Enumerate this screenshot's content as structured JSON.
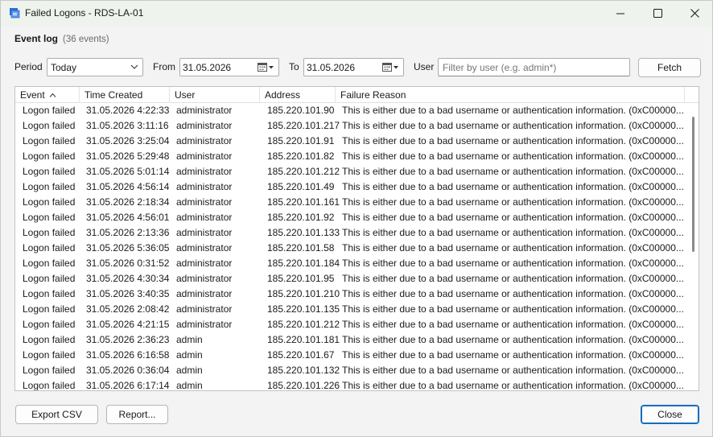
{
  "window": {
    "title": "Failed Logons - RDS-LA-01"
  },
  "header": {
    "title": "Event log",
    "count": "(36 events)"
  },
  "toolbar": {
    "period_label": "Period",
    "period_value": "Today",
    "from_label": "From",
    "from_value": "31.05.2026",
    "to_label": "To",
    "to_value": "31.05.2026",
    "user_label": "User",
    "user_placeholder": "Filter by user (e.g. admin*)",
    "fetch_label": "Fetch"
  },
  "grid": {
    "columns": [
      "Event",
      "Time Created",
      "User",
      "Address",
      "Failure Reason"
    ],
    "sort_indicator": "^",
    "rows": [
      [
        "Logon failed",
        "31.05.2026 4:22:33",
        "administrator",
        "185.220.101.90",
        "This is either due to a bad username or authentication information. (0xC00000..."
      ],
      [
        "Logon failed",
        "31.05.2026 3:11:16",
        "administrator",
        "185.220.101.217",
        "This is either due to a bad username or authentication information. (0xC00000..."
      ],
      [
        "Logon failed",
        "31.05.2026 3:25:04",
        "administrator",
        "185.220.101.91",
        "This is either due to a bad username or authentication information. (0xC00000..."
      ],
      [
        "Logon failed",
        "31.05.2026 5:29:48",
        "administrator",
        "185.220.101.82",
        "This is either due to a bad username or authentication information. (0xC00000..."
      ],
      [
        "Logon failed",
        "31.05.2026 5:01:14",
        "administrator",
        "185.220.101.212",
        "This is either due to a bad username or authentication information. (0xC00000..."
      ],
      [
        "Logon failed",
        "31.05.2026 4:56:14",
        "administrator",
        "185.220.101.49",
        "This is either due to a bad username or authentication information. (0xC00000..."
      ],
      [
        "Logon failed",
        "31.05.2026 2:18:34",
        "administrator",
        "185.220.101.161",
        "This is either due to a bad username or authentication information. (0xC00000..."
      ],
      [
        "Logon failed",
        "31.05.2026 4:56:01",
        "administrator",
        "185.220.101.92",
        "This is either due to a bad username or authentication information. (0xC00000..."
      ],
      [
        "Logon failed",
        "31.05.2026 2:13:36",
        "administrator",
        "185.220.101.133",
        "This is either due to a bad username or authentication information. (0xC00000..."
      ],
      [
        "Logon failed",
        "31.05.2026 5:36:05",
        "administrator",
        "185.220.101.58",
        "This is either due to a bad username or authentication information. (0xC00000..."
      ],
      [
        "Logon failed",
        "31.05.2026 0:31:52",
        "administrator",
        "185.220.101.184",
        "This is either due to a bad username or authentication information. (0xC00000..."
      ],
      [
        "Logon failed",
        "31.05.2026 4:30:34",
        "administrator",
        "185.220.101.95",
        "This is either due to a bad username or authentication information. (0xC00000..."
      ],
      [
        "Logon failed",
        "31.05.2026 3:40:35",
        "administrator",
        "185.220.101.210",
        "This is either due to a bad username or authentication information. (0xC00000..."
      ],
      [
        "Logon failed",
        "31.05.2026 2:08:42",
        "administrator",
        "185.220.101.135",
        "This is either due to a bad username or authentication information. (0xC00000..."
      ],
      [
        "Logon failed",
        "31.05.2026 4:21:15",
        "administrator",
        "185.220.101.212",
        "This is either due to a bad username or authentication information. (0xC00000..."
      ],
      [
        "Logon failed",
        "31.05.2026 2:36:23",
        "admin",
        "185.220.101.181",
        "This is either due to a bad username or authentication information. (0xC00000..."
      ],
      [
        "Logon failed",
        "31.05.2026 6:16:58",
        "admin",
        "185.220.101.67",
        "This is either due to a bad username or authentication information. (0xC00000..."
      ],
      [
        "Logon failed",
        "31.05.2026 0:36:04",
        "admin",
        "185.220.101.132",
        "This is either due to a bad username or authentication information. (0xC00000..."
      ],
      [
        "Logon failed",
        "31.05.2026 6:17:14",
        "admin",
        "185.220.101.226",
        "This is either due to a bad username or authentication information. (0xC00000..."
      ]
    ]
  },
  "footer": {
    "export_label": "Export CSV",
    "report_label": "Report...",
    "close_label": "Close"
  },
  "icons": {
    "app": "event-log-app-icon",
    "minimize": "minimize-icon",
    "maximize": "maximize-icon",
    "close": "close-icon",
    "dropdown": "chevron-down-icon",
    "calendar": "calendar-icon"
  },
  "colors": {
    "accent": "#0f6cbd",
    "titlebar": "#eef3ee",
    "window_bg": "#f3f3f3"
  }
}
